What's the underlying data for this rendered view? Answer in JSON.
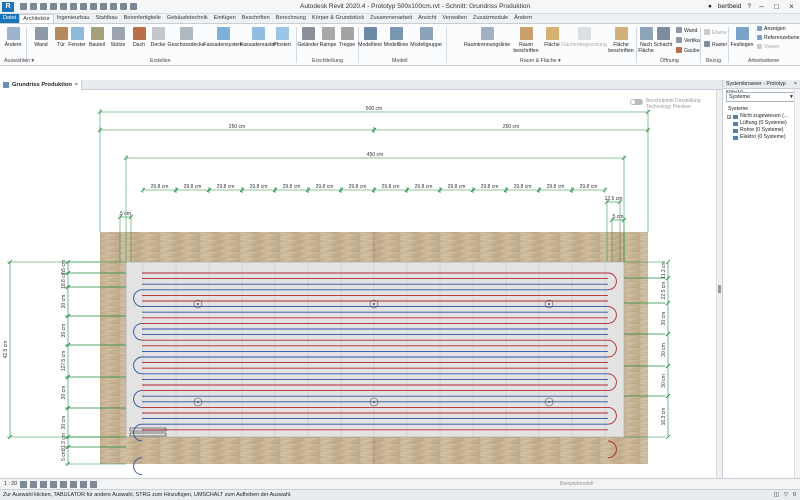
{
  "app": {
    "logo": "R",
    "title": "Autodesk Revit 2020.4 - Prototyp 500x100cm.rvt - Schnitt: Grundriss Produktion",
    "user": "bertbeid"
  },
  "tabs": [
    "Datei",
    "Architektur",
    "Ingenieurbau",
    "Stahlbau",
    "Betonfertigteile",
    "Gebäudetechnik",
    "Einfügen",
    "Beschriften",
    "Berechnung",
    "Körper & Grundstück",
    "Zusammenarbeit",
    "Ansicht",
    "Verwalten",
    "Zusatzmodule",
    "Ändern"
  ],
  "ribbon": {
    "buttons": [
      "Ändern",
      "Wand",
      "Tür",
      "Fenster",
      "Bauteil",
      "Stütze",
      "Dach",
      "Decke",
      "Geschossdecke",
      "Fassadensystem",
      "Fassadenraster",
      "Pfosten",
      "Geländer",
      "Rampe",
      "Treppe",
      "Modelltext",
      "Modelllinie",
      "Modellgruppe",
      "Raumtrennungslinie",
      "Raum beschriften",
      "Fläche",
      "Flächenbegrenzung",
      "Fläche beschriften",
      "Nach Fläche",
      "Schacht",
      "Wand",
      "Vertikal",
      "Gaube",
      "Ebene",
      "Raster",
      "Festlegen",
      "Anzeigen",
      "Referenzebene",
      "Viewer"
    ],
    "panels": [
      "Auswählen ▾",
      "Erstellen",
      "Erschließung",
      "Modell",
      "Raum & Fläche ▾",
      "Öffnung",
      "Bezug",
      "Arbeitsebene"
    ]
  },
  "view": {
    "tab_label": "Grundriss Produktion",
    "toggle_label_1": "Beschränkte Darstellung",
    "toggle_label_2": "Technology Preview"
  },
  "dimensions": {
    "top_total": "500 cm",
    "half_left": "250 cm",
    "half_right": "250 cm",
    "inner": "450 cm",
    "seg": "29.8 cm",
    "edge_left": "5 cm",
    "edge_right_a": "12.5 cm",
    "edge_right_b": "5 cm",
    "left_outer": "42.5 cm",
    "left_values": [
      "7.5 cm",
      "18.8 cm",
      "30 cm",
      "30 cm",
      "127.5 cm",
      "30 cm",
      "30 cm",
      "31.3 cm",
      "5 cm"
    ],
    "right_values": [
      "11.3 cm",
      "22.5 cm",
      "30 cm",
      "30 cm",
      "30 cm",
      "16.3 cm"
    ]
  },
  "sidepanel": {
    "title": "Systembrowser - Prototyp 500x10...",
    "select": "Systeme",
    "root": "Systeme",
    "items": [
      "Nicht zugewiesen (...",
      "Lüftung (0 Systeme)",
      "Rohre (0 Systeme)",
      "Elektro (0 Systeme)"
    ]
  },
  "statusstrip": {
    "scale": "1 : 20",
    "mode": "Beispielmodell"
  },
  "statusbar": {
    "message": "Zur Auswahl klicken, TABULATOR für andere Auswahl, STRG zum Hinzufügen, UMSCHALT zum Aufheben der Auswahl.",
    "filter": "0"
  },
  "colors": {
    "accent": "#1b75bb",
    "dimension": "#1a8a3a",
    "wood": "#c9b79a",
    "pipe_red": "#b2272d",
    "pipe_blue": "#2d4fa3"
  }
}
